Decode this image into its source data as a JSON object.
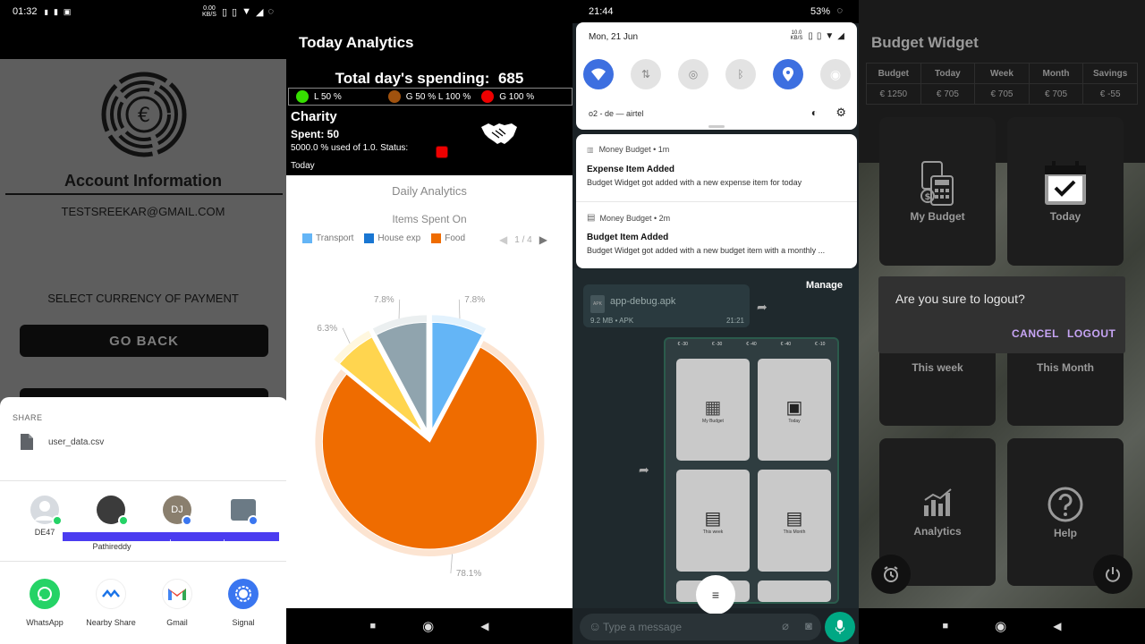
{
  "panel1": {
    "status": {
      "time": "01:32",
      "speed_top": "0.00",
      "speed_bottom": "KB/S"
    },
    "account_title": "Account Information",
    "email": "TESTSREEKAR@GMAIL.COM",
    "select_currency": "SELECT CURRENCY OF PAYMENT",
    "go_back": "GO BACK",
    "share": {
      "label": "SHARE",
      "file_name": "user_data.csv",
      "contacts": [
        {
          "name": "DE47",
          "initials": ""
        },
        {
          "name": "Pathireddy",
          "initials": ""
        },
        {
          "name": "",
          "initials": "DJ"
        },
        {
          "name": "",
          "initials": ""
        }
      ],
      "apps": [
        {
          "name": "WhatsApp",
          "icon": "whatsapp-icon"
        },
        {
          "name": "Nearby Share",
          "icon": "nearby-share-icon"
        },
        {
          "name": "Gmail",
          "icon": "gmail-icon"
        },
        {
          "name": "Signal",
          "icon": "signal-icon"
        }
      ]
    }
  },
  "panel2": {
    "title": "Today Analytics",
    "total_label": "Total day's spending:",
    "total_value": "685",
    "legend": [
      {
        "label": "L 50 %",
        "color": "#36e000"
      },
      {
        "label": "G 50 % L 100 %",
        "color": "#a0520e"
      },
      {
        "label": "G 100 %",
        "color": "#ee0000"
      }
    ],
    "charity": {
      "name": "Charity",
      "spent": "Spent: 50",
      "usage": "5000.0 % used of 1.0. Status:",
      "period": "Today"
    },
    "daily_analytics": "Daily Analytics",
    "items_spent_on": "Items Spent On",
    "chart_legend": [
      {
        "label": "Transport",
        "color": "#64b5f6"
      },
      {
        "label": "House exp",
        "color": "#1976d2"
      },
      {
        "label": "Food",
        "color": "#ef6c00"
      }
    ],
    "pager": "1 / 4"
  },
  "chart_data": {
    "type": "pie",
    "title": "Items Spent On",
    "slices": [
      {
        "label": "Food",
        "value": 78.1,
        "display": "78.1%",
        "color": "#ef6c00"
      },
      {
        "label": "",
        "value": 6.3,
        "display": "6.3%",
        "color": "#ffd54f"
      },
      {
        "label": "",
        "value": 7.8,
        "display": "7.8%",
        "color": "#90a4ae"
      },
      {
        "label": "Transport",
        "value": 7.8,
        "display": "7.8%",
        "color": "#64b5f6"
      }
    ]
  },
  "panel3": {
    "status": {
      "time": "21:44",
      "battery": "53%"
    },
    "date": "Mon, 21 Jun",
    "speed_top": "10.0",
    "speed_bottom": "KB/S",
    "network": "o2 - de — airtel",
    "notifications": [
      {
        "app": "Money Budget",
        "time": "1m",
        "title": "Expense Item Added",
        "body": "Budget Widget got added with a new expense item for today"
      },
      {
        "app": "Money Budget",
        "time": "2m",
        "title": "Budget Item Added",
        "body": "Budget Widget got added with a new budget item with a monthly ..."
      }
    ],
    "manage": "Manage",
    "apk": {
      "name": "app-debug.apk",
      "meta": "9.2 MB • APK",
      "time": "21:21"
    },
    "mini_cards": [
      "My Budget",
      "Today",
      "This week",
      "This Month"
    ],
    "message_placeholder": "Type a message"
  },
  "panel4": {
    "title": "Budget Widget",
    "table_headers": [
      "Budget",
      "Today",
      "Week",
      "Month",
      "Savings"
    ],
    "table_values": [
      "€ 1250",
      "€ 705",
      "€ 705",
      "€ 705",
      "€ -55"
    ],
    "cards": [
      "My Budget",
      "Today",
      "This week",
      "This Month",
      "Analytics",
      "Help"
    ],
    "dialog": {
      "question": "Are you sure to logout?",
      "cancel": "CANCEL",
      "logout": "LOGOUT"
    }
  }
}
